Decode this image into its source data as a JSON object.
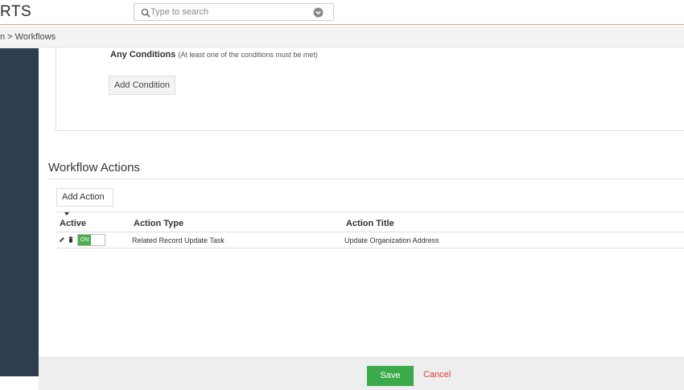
{
  "header": {
    "logo_text": "RTS",
    "search_placeholder": "Type to search"
  },
  "breadcrumb": {
    "text": "n > Workflows"
  },
  "conditions": {
    "any_label": "Any Conditions",
    "any_hint": "(At least one of the conditions must be met)",
    "add_condition_label": "Add Condition"
  },
  "workflow_actions": {
    "title": "Workflow Actions",
    "add_action_label": "Add Action",
    "columns": {
      "active": "Active",
      "action_type": "Action Type",
      "action_title": "Action Title"
    },
    "rows": [
      {
        "toggle_label": "ON",
        "action_type": "Related Record Update Task",
        "action_title": "Update Organization Address"
      }
    ]
  },
  "footer": {
    "save_label": "Save",
    "cancel_label": "Cancel"
  },
  "colors": {
    "sidebar": "#2c3e50",
    "accent_line": "#e8a07a",
    "save_green": "#3aaa4b",
    "toggle_green": "#4cae4c",
    "cancel_red": "#e53935"
  }
}
